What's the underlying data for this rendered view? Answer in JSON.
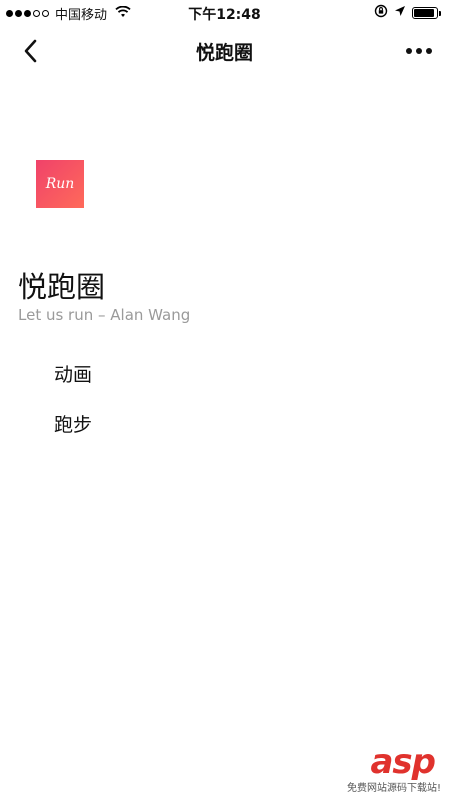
{
  "status_bar": {
    "carrier": "中国移动",
    "time": "下午12:48",
    "battery_level": 0.9,
    "icons": [
      "wifi-icon",
      "orientation-lock-icon",
      "location-arrow-icon",
      "battery-icon"
    ]
  },
  "nav": {
    "title": "悦跑圈",
    "back_icon": "chevron-left-icon",
    "more_icon": "more-dots-icon"
  },
  "app": {
    "logo_text": "Run",
    "logo_colors": [
      "#f0426a",
      "#ff6a5a"
    ],
    "title": "悦跑圈",
    "subtitle": "Let us run – Alan Wang"
  },
  "menu": {
    "items": [
      {
        "label": "动画"
      },
      {
        "label": "跑步"
      }
    ]
  },
  "watermark": {
    "main": "asp",
    "sub": "免费网站源码下载站!"
  }
}
